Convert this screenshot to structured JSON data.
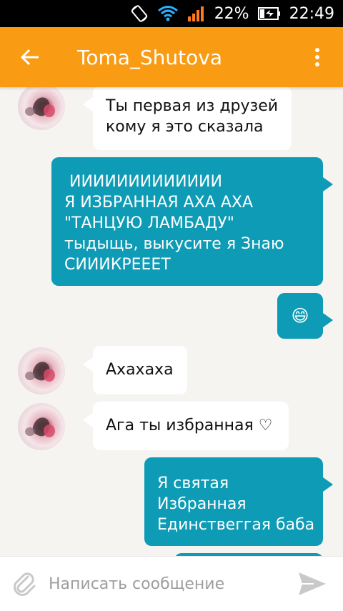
{
  "status_bar": {
    "battery_percent": "22%",
    "time": "22:49"
  },
  "app_bar": {
    "title": "Toma_Shutova"
  },
  "messages": [
    {
      "direction": "in",
      "lines": [
        "Ты первая из друзей",
        "кому я это сказала"
      ]
    },
    {
      "direction": "out",
      "lines": [
        " ИИИИИИИИИИИИИ",
        "Я ИЗБРАННАЯ АХА АХА",
        "\"ТАНЦУЮ ЛАМБАДУ\"",
        "тыдыщь, выкусите я Знаю",
        "СИИИКРЕЕЕТ"
      ]
    },
    {
      "direction": "out",
      "lines": [
        "😄"
      ]
    },
    {
      "direction": "in",
      "lines": [
        "Ахахаха"
      ]
    },
    {
      "direction": "in",
      "lines": [
        "Ага ты избранная ♡"
      ]
    },
    {
      "direction": "out",
      "lines": [
        "Я святая",
        "Избранная",
        "Единствеггая баба"
      ]
    }
  ],
  "composer": {
    "placeholder": "Написать сообщение"
  },
  "colors": {
    "app_bar": "#fa9b14",
    "outgoing_bubble": "#0d9bb5",
    "incoming_bubble": "#ffffff",
    "background": "#f6f4f0"
  }
}
